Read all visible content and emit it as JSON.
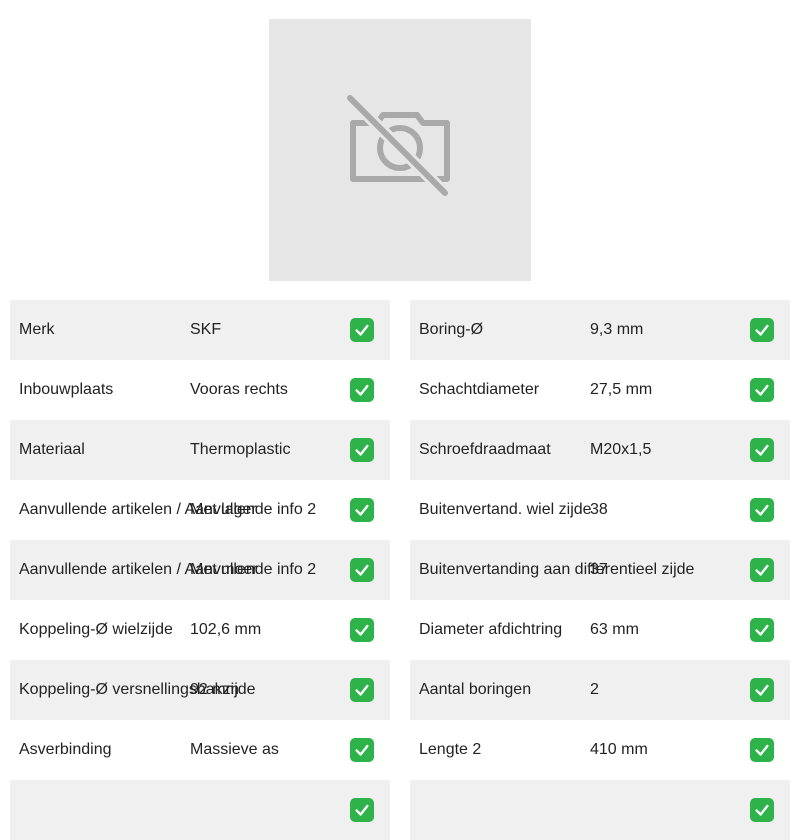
{
  "image": {
    "icon": "camera-off-icon"
  },
  "left_table": [
    {
      "label": "Merk",
      "value": "SKF"
    },
    {
      "label": "Inbouwplaats",
      "value": "Vooras rechts"
    },
    {
      "label": "Materiaal",
      "value": "Thermoplastic"
    },
    {
      "label": "Aanvullende artikelen / Aanvullende info 2",
      "value": "Met lager"
    },
    {
      "label": "Aanvullende artikelen / Aanvullende info 2",
      "value": "Met moer"
    },
    {
      "label": "Koppeling-Ø wielzijde",
      "value": "102,6 mm"
    },
    {
      "label": "Koppeling-Ø versnellingsbakzijde",
      "value": "92 mm"
    },
    {
      "label": "Asverbinding",
      "value": "Massieve as"
    },
    {
      "label": "",
      "value": ""
    }
  ],
  "right_table": [
    {
      "label": "Boring-Ø",
      "value": "9,3 mm"
    },
    {
      "label": "Schachtdiameter",
      "value": "27,5 mm"
    },
    {
      "label": "Schroefdraadmaat",
      "value": "M20x1,5"
    },
    {
      "label": "Buitenvertand. wiel zijde",
      "value": "38"
    },
    {
      "label": "Buitenvertanding aan differentieel zijde",
      "value": "37"
    },
    {
      "label": "Diameter afdichtring",
      "value": "63 mm"
    },
    {
      "label": "Aantal boringen",
      "value": "2"
    },
    {
      "label": "Lengte 2",
      "value": "410 mm"
    },
    {
      "label": "",
      "value": ""
    }
  ],
  "colors": {
    "check": "#2eb34a",
    "row_alt": "#f0f0f0",
    "placeholder": "#e6e6e6"
  }
}
